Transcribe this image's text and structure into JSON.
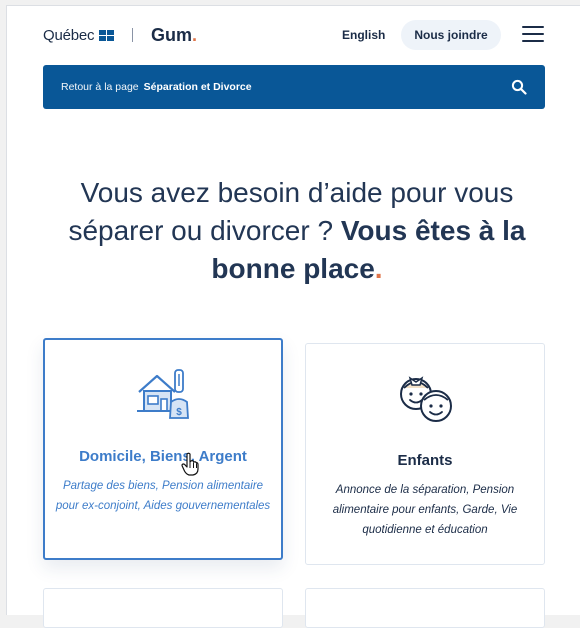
{
  "header": {
    "logo_quebec": "Québec",
    "logo_gum": "Gum",
    "logo_gum_dot": ".",
    "lang_link": "English",
    "contact_button": "Nous joindre",
    "menu_icon": "hamburger-icon"
  },
  "backbar": {
    "prefix": "Retour à la page",
    "page": "Séparation et Divorce",
    "search_icon": "search-icon"
  },
  "hero": {
    "line_light": "Vous avez besoin d’aide pour vous séparer ou divorcer ?",
    "line_strong": "Vous êtes à la bonne place",
    "dot": "."
  },
  "cards": [
    {
      "icon": "house-money-icon",
      "title": "Domicile, Biens, Argent",
      "description": "Partage des biens, Pension alimentaire pour ex-conjoint, Aides gouvernementales"
    },
    {
      "icon": "children-faces-icon",
      "title": "Enfants",
      "description": "Annonce de la séparation, Pension alimentaire pour enfants, Garde, Vie quotidienne et éducation"
    }
  ],
  "colors": {
    "brand_blue": "#095797",
    "accent_orange": "#e0754a",
    "active_blue": "#3d7cc9",
    "text_dark": "#223654"
  }
}
